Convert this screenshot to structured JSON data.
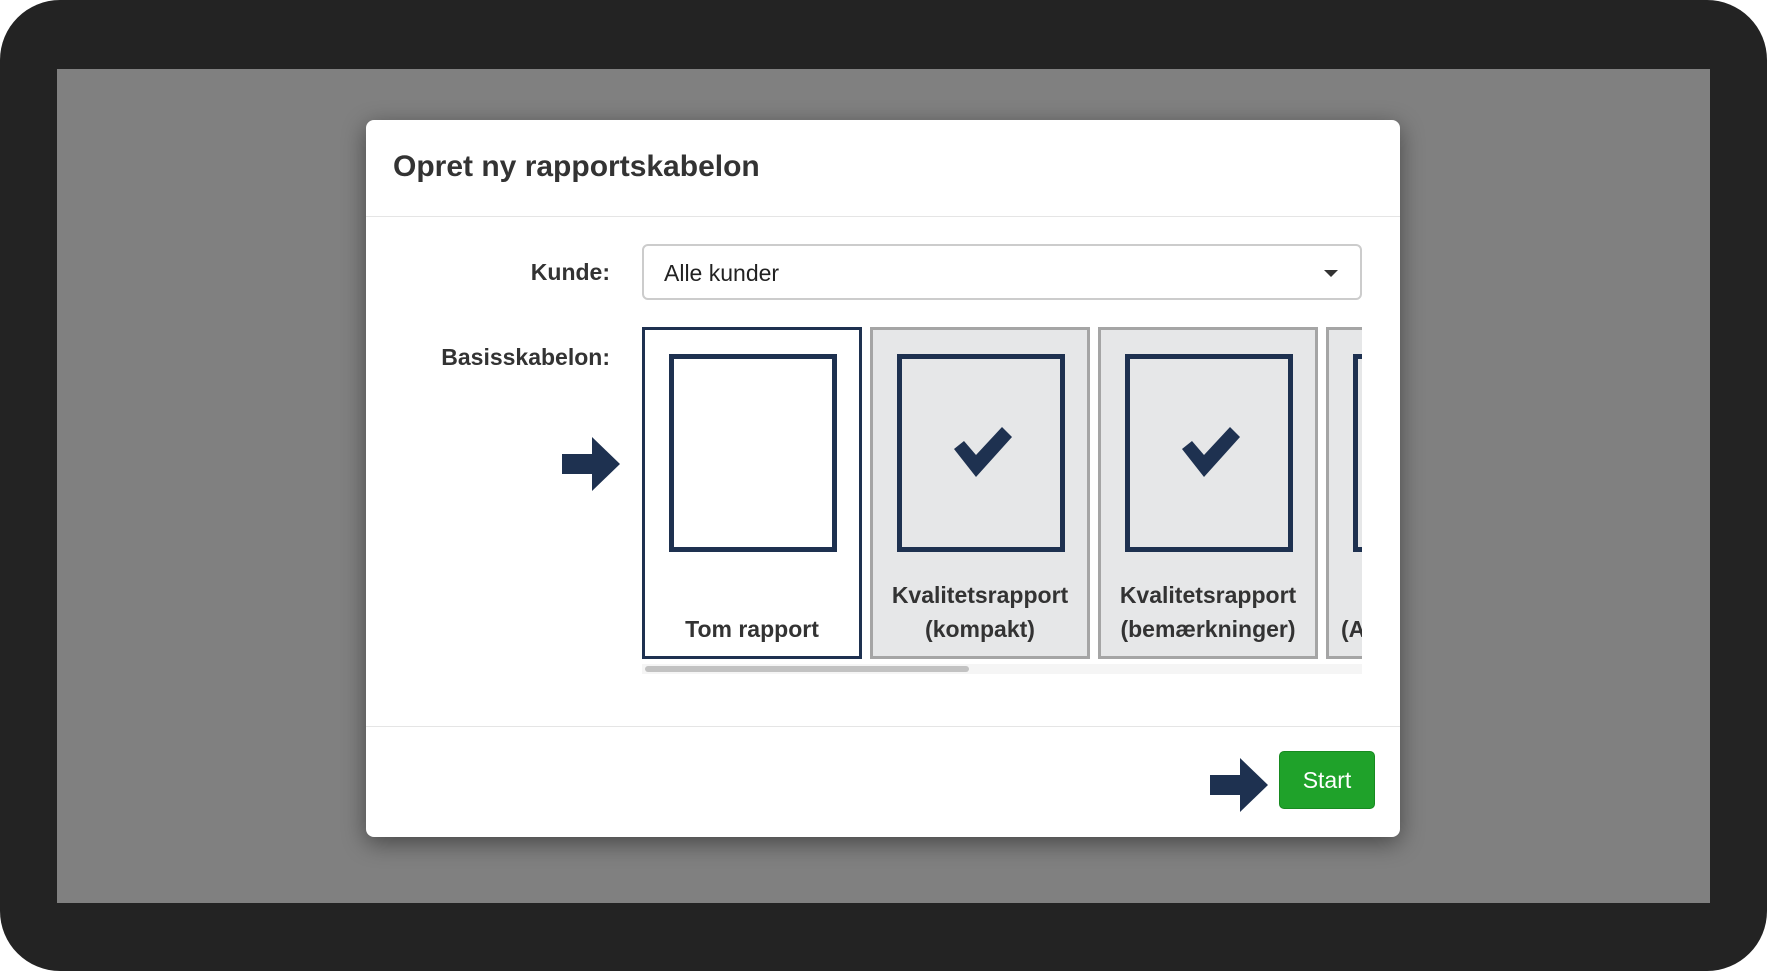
{
  "dialog": {
    "title": "Opret ny rapportskabelon"
  },
  "form": {
    "customer_label": "Kunde:",
    "customer_value": "Alle kunder",
    "base_template_label": "Basisskabelon:"
  },
  "templates": [
    {
      "label_line1": "",
      "label_line2": "Tom rapport",
      "selected": true
    },
    {
      "label_line1": "Kvalitetsrapport",
      "label_line2": "(kompakt)",
      "selected": false
    },
    {
      "label_line1": "Kvalitetsrapport",
      "label_line2": "(bemærkninger)",
      "selected": false
    },
    {
      "label_line1": "",
      "label_line2": "(A",
      "selected": false
    }
  ],
  "template_scroll": {
    "visible_fraction": 0.45,
    "position_fraction": 0
  },
  "footer": {
    "start_label": "Start"
  },
  "colors": {
    "accent_navy": "#1e3150",
    "start_green": "#1fa22a",
    "overlay_gray": "#808080",
    "frame_dark": "#232323",
    "card_gray": "#e6e7e8"
  },
  "icons": {
    "dropdown": "caret-down-icon",
    "pointer": "arrow-right-icon",
    "template_check": "checkmark-icon"
  }
}
